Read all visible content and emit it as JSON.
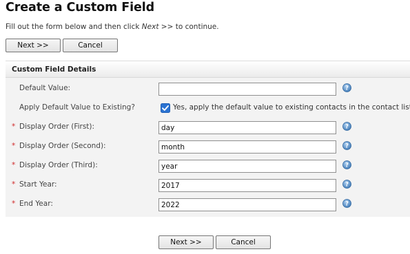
{
  "page": {
    "title": "Create a Custom Field",
    "instructions_before": "Fill out the form below and then click ",
    "instructions_em": "Next >>",
    "instructions_after": " to continue."
  },
  "buttons": {
    "next_label": "Next >>",
    "cancel_label": "Cancel"
  },
  "panel": {
    "title": "Custom Field Details"
  },
  "form": {
    "required_marker": "*",
    "default_value": {
      "label": "Default Value:",
      "value": ""
    },
    "apply_default": {
      "label": "Apply Default Value to Existing?",
      "checked": true,
      "checkbox_text": "Yes, apply the default value to existing contacts in the contact list(s)."
    },
    "display_order_first": {
      "label": "Display Order (First):",
      "value": "day",
      "required": true
    },
    "display_order_second": {
      "label": "Display Order (Second):",
      "value": "month",
      "required": true
    },
    "display_order_third": {
      "label": "Display Order (Third):",
      "value": "year",
      "required": true
    },
    "start_year": {
      "label": "Start Year:",
      "value": "2017",
      "required": true
    },
    "end_year": {
      "label": "End Year:",
      "value": "2022",
      "required": true
    }
  },
  "icons": {
    "help": "help-icon",
    "checkbox": "checkbox-checked-icon"
  },
  "colors": {
    "required": "#d0292a",
    "checkbox": "#2b73d2",
    "help_icon": "#5a90c6"
  }
}
